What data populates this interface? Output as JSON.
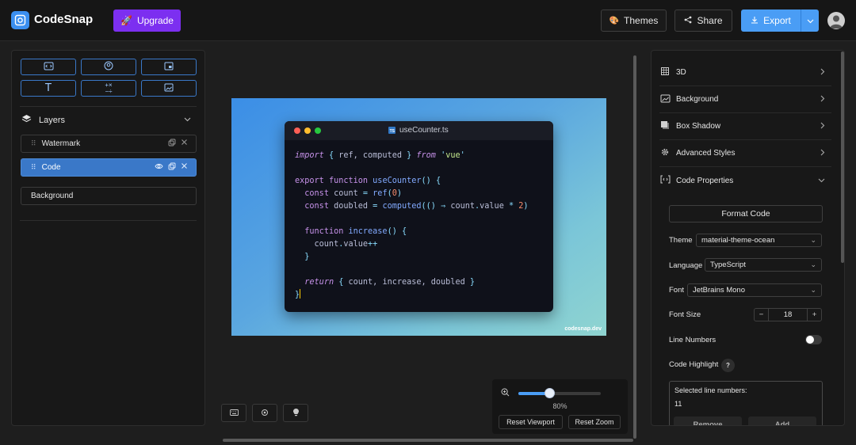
{
  "app": {
    "name": "CodeSnap",
    "upgrade_label": "Upgrade"
  },
  "header": {
    "themes_label": "Themes",
    "share_label": "Share",
    "export_label": "Export"
  },
  "left_panel": {
    "tools": [
      "code-block-icon",
      "avatar-icon",
      "window-icon",
      "text-icon",
      "symbols-icon",
      "image-icon"
    ],
    "layers_title": "Layers",
    "layers": [
      {
        "name": "Watermark",
        "active": false
      },
      {
        "name": "Code",
        "active": true
      }
    ],
    "background_label": "Background"
  },
  "snapshot": {
    "file_name": "useCounter.ts",
    "watermark": "codesnap.dev",
    "language_badge": "TS"
  },
  "zoom": {
    "level_label": "80%",
    "value": 0.38,
    "reset_viewport": "Reset Viewport",
    "reset_zoom": "Reset Zoom"
  },
  "right_panel": {
    "sections": [
      {
        "label": "3D",
        "icon": "cube-icon",
        "expanded": false
      },
      {
        "label": "Background",
        "icon": "image-icon",
        "expanded": false
      },
      {
        "label": "Box Shadow",
        "icon": "shadow-icon",
        "expanded": false
      },
      {
        "label": "Advanced Styles",
        "icon": "gear-icon",
        "expanded": false
      },
      {
        "label": "Code Properties",
        "icon": "code-icon",
        "expanded": true
      }
    ],
    "format_code": "Format Code",
    "theme_label": "Theme",
    "theme_value": "material-theme-ocean",
    "language_label": "Language",
    "language_value": "TypeScript",
    "font_label": "Font",
    "font_value": "JetBrains Mono",
    "font_size_label": "Font Size",
    "font_size_value": "18",
    "line_numbers_label": "Line Numbers",
    "line_numbers_on": false,
    "code_highlight_label": "Code Highlight",
    "selected_lines_label": "Selected line numbers:",
    "selected_lines_value": "11",
    "remove_label": "Remove",
    "add_label": "Add"
  },
  "colors": {
    "accent": "#4a9df5",
    "upgrade": "#7c2ff0",
    "layer_active": "#3a78c8"
  }
}
